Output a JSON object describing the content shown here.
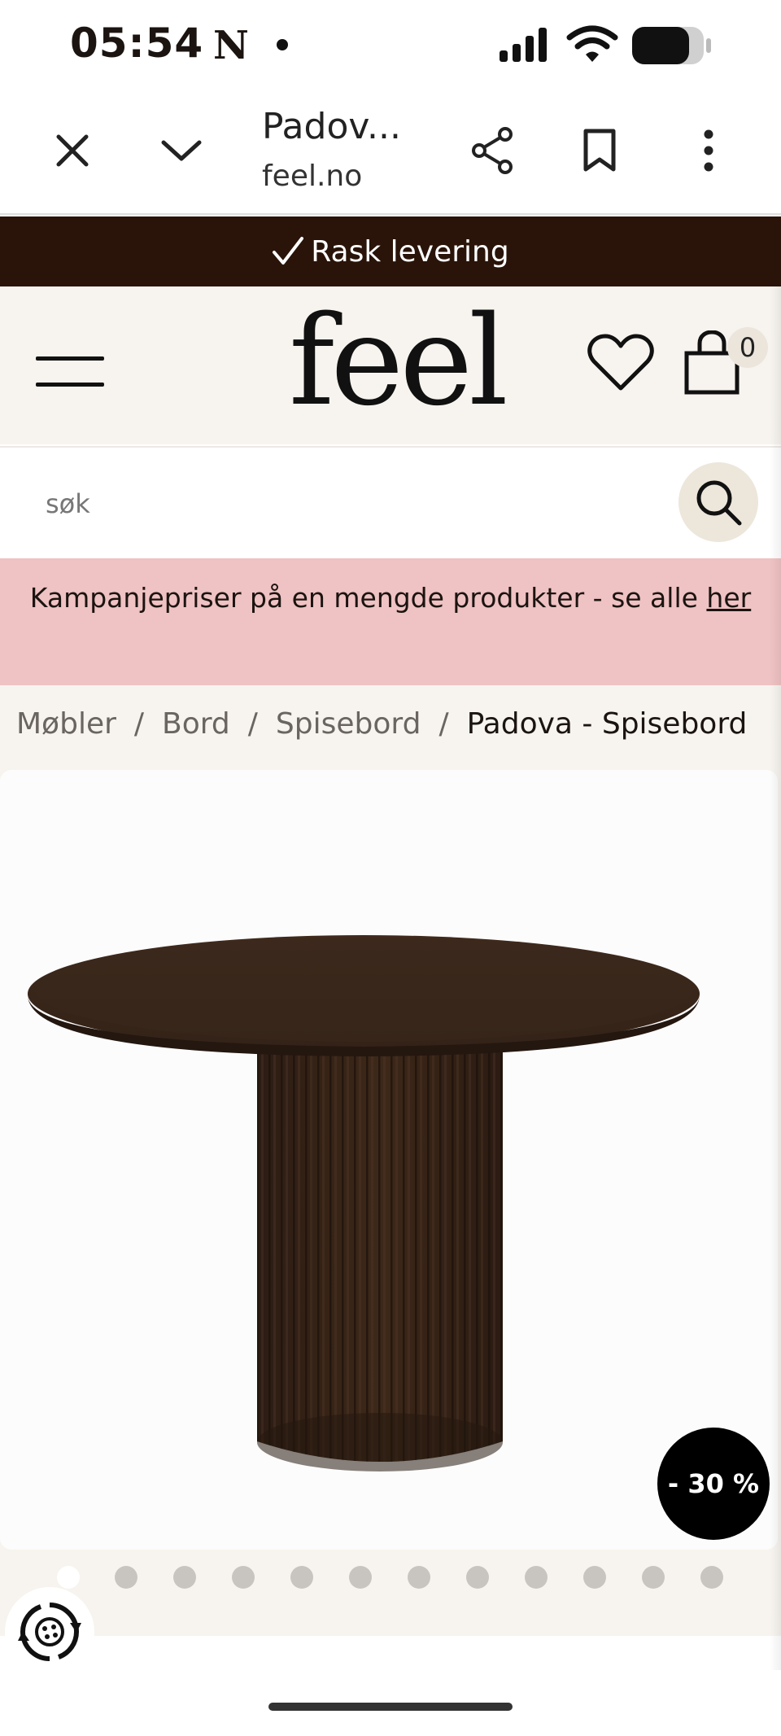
{
  "status_bar": {
    "time": "05:54",
    "app_badge": "N"
  },
  "browser": {
    "page_title": "Padov...",
    "url": "feel.no"
  },
  "promo_strip": {
    "text": "Rask levering"
  },
  "header": {
    "logo": "feel",
    "cart_count": "0"
  },
  "search": {
    "placeholder": "søk"
  },
  "campaign": {
    "text": "Kampanjepriser på en mengde produkter - se alle",
    "link": "her"
  },
  "breadcrumb": {
    "items": [
      "Møbler",
      "Bord",
      "Spisebord"
    ],
    "separator": "/",
    "current": "Padova - Spisebord"
  },
  "product": {
    "discount_badge": "- 30 %",
    "image_count": 12,
    "active_image": 0
  },
  "colors": {
    "strip_bg": "#2a1409",
    "header_bg": "#f7f4ef",
    "campaign_bg": "#efc2c3",
    "badge_bg": "#000000",
    "search_button_bg": "#ede6db"
  },
  "icons": [
    "close-icon",
    "chevron-down-icon",
    "share-icon",
    "bookmark-icon",
    "more-vertical-icon",
    "check-icon",
    "hamburger-menu-icon",
    "heart-icon",
    "shopping-bag-icon",
    "search-icon",
    "accessibility-icon"
  ]
}
